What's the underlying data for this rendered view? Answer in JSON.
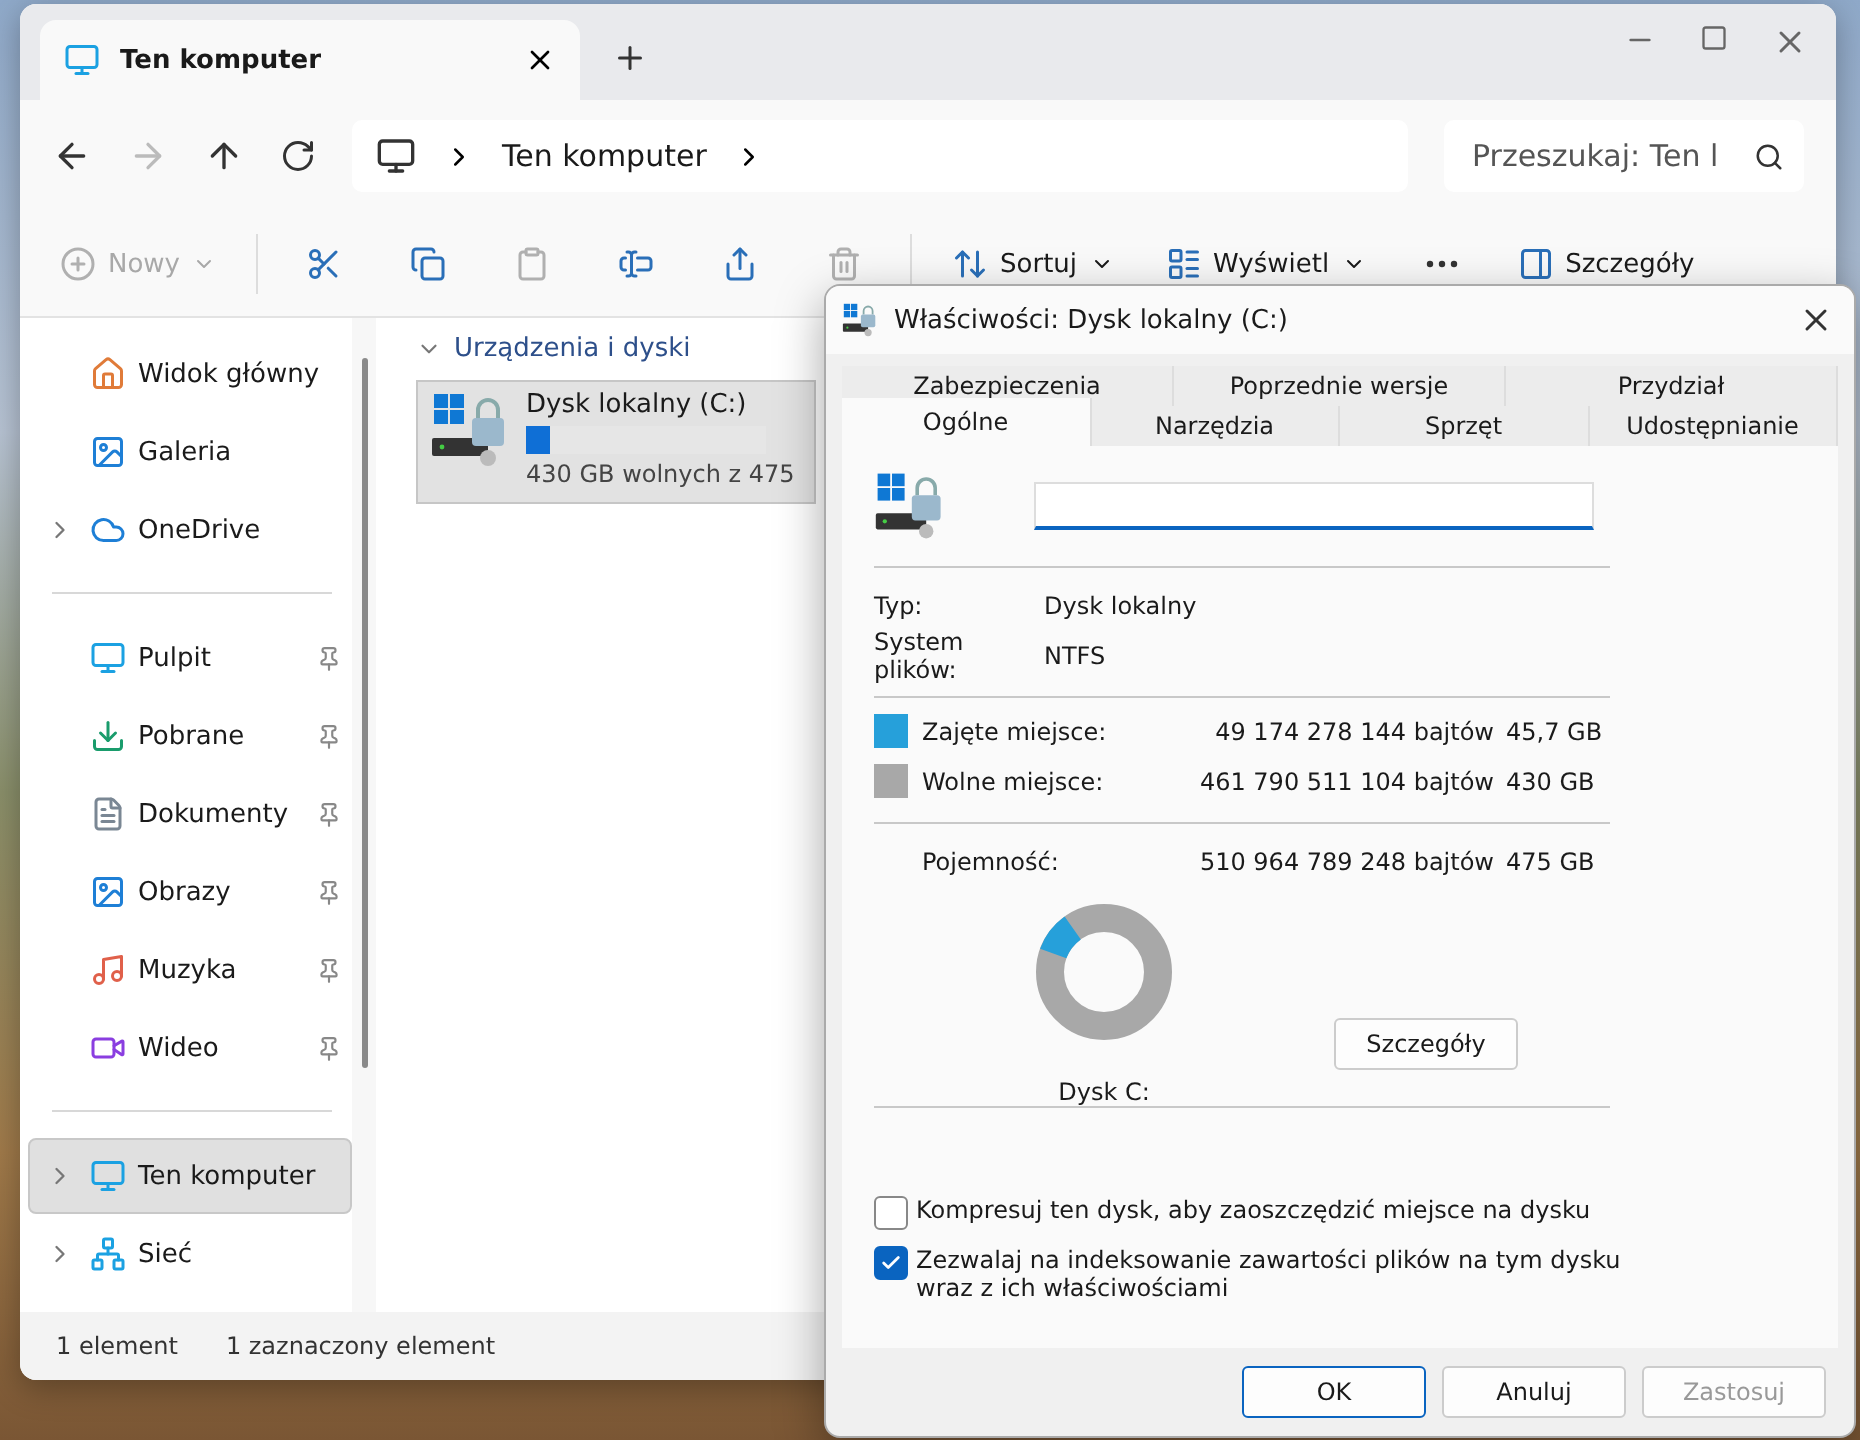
{
  "explorer": {
    "tab": {
      "title": "Ten komputer"
    },
    "breadcrumb": [
      "Ten komputer"
    ],
    "search": {
      "placeholder": "Przeszukaj: Ten l"
    },
    "toolbar": [
      {
        "kind": "menu",
        "label": "Nowy",
        "disabled": true
      },
      {
        "kind": "divider"
      },
      {
        "kind": "icon",
        "disabled": false
      },
      {
        "kind": "icon",
        "disabled": false
      },
      {
        "kind": "icon",
        "disabled": true
      },
      {
        "kind": "icon",
        "disabled": false
      },
      {
        "kind": "icon",
        "disabled": false
      },
      {
        "kind": "icon",
        "disabled": true
      },
      {
        "kind": "divider"
      },
      {
        "kind": "menu",
        "label": "Sortuj",
        "disabled": false
      },
      {
        "kind": "menu",
        "label": "Wyświetl",
        "disabled": false
      },
      {
        "kind": "more",
        "disabled": false
      },
      {
        "kind": "button",
        "label": "Szczegóły",
        "disabled": false
      }
    ],
    "sidebar": {
      "groups": [
        [
          {
            "label": "Widok główny",
            "expandable": false,
            "pinned": false,
            "selected": false
          },
          {
            "label": "Galeria",
            "expandable": false,
            "pinned": false,
            "selected": false
          },
          {
            "label": "OneDrive",
            "expandable": true,
            "pinned": false,
            "selected": false
          }
        ],
        [
          {
            "label": "Pulpit",
            "expandable": false,
            "pinned": true,
            "selected": false
          },
          {
            "label": "Pobrane",
            "expandable": false,
            "pinned": true,
            "selected": false
          },
          {
            "label": "Dokumenty",
            "expandable": false,
            "pinned": true,
            "selected": false
          },
          {
            "label": "Obrazy",
            "expandable": false,
            "pinned": true,
            "selected": false
          },
          {
            "label": "Muzyka",
            "expandable": false,
            "pinned": true,
            "selected": false
          },
          {
            "label": "Wideo",
            "expandable": false,
            "pinned": true,
            "selected": false
          }
        ],
        [
          {
            "label": "Ten komputer",
            "expandable": true,
            "pinned": false,
            "selected": true
          },
          {
            "label": "Sieć",
            "expandable": true,
            "pinned": false,
            "selected": false
          }
        ]
      ]
    },
    "section": {
      "title": "Urządzenia i dyski",
      "expanded": true
    },
    "drives": [
      {
        "name": "Dysk lokalny (C:)",
        "level": 0.096,
        "free": "430 GB wolnych z 475",
        "selected": true
      }
    ],
    "status_bar": [
      "1 element",
      "1 zaznaczony element"
    ]
  },
  "dialog": {
    "title": "Właściwości: Dysk lokalny (C:)",
    "tab_rows": [
      [
        {
          "label": "Zabezpieczenia",
          "selected": false
        },
        {
          "label": "Poprzednie wersje",
          "selected": false
        },
        {
          "label": "Przydział",
          "selected": false
        }
      ],
      [
        {
          "label": "Ogólne",
          "selected": true
        },
        {
          "label": "Narzędzia",
          "selected": false
        },
        {
          "label": "Sprzęt",
          "selected": false
        },
        {
          "label": "Udostępnianie",
          "selected": false
        }
      ]
    ],
    "info": [
      {
        "label": "Typ:",
        "value": "Dysk lokalny"
      },
      {
        "label": "System plików:",
        "value": "NTFS"
      }
    ],
    "usage": [
      {
        "label": "Zajęte miejsce:",
        "bytes": "49 174 278 144 bajtów",
        "size": "45,7 GB",
        "color": "#26a0da"
      },
      {
        "label": "Wolne miejsce:",
        "bytes": "461 790 511 104 bajtów",
        "size": "430 GB",
        "color": "#a8a8a8"
      }
    ],
    "capacity": {
      "label": "Pojemność:",
      "bytes": "510 964 789 248 bajtów",
      "size": "475 GB"
    },
    "donut": {
      "level": 0.096,
      "label": "Dysk C:"
    },
    "details_button": "Szczegóły",
    "options": [
      {
        "label": "Kompresuj ten dysk, aby zaoszczędzić miejsce na dysku",
        "checked": false
      },
      {
        "label": "Zezwalaj na indeksowanie zawartości plików na tym dysku wraz z ich właściwościami",
        "checked": true
      }
    ],
    "buttons": [
      {
        "label": "OK",
        "kind": "default",
        "disabled": false
      },
      {
        "label": "Anuluj",
        "kind": "normal",
        "disabled": false
      },
      {
        "label": "Zastosuj",
        "kind": "normal",
        "disabled": true
      }
    ]
  }
}
